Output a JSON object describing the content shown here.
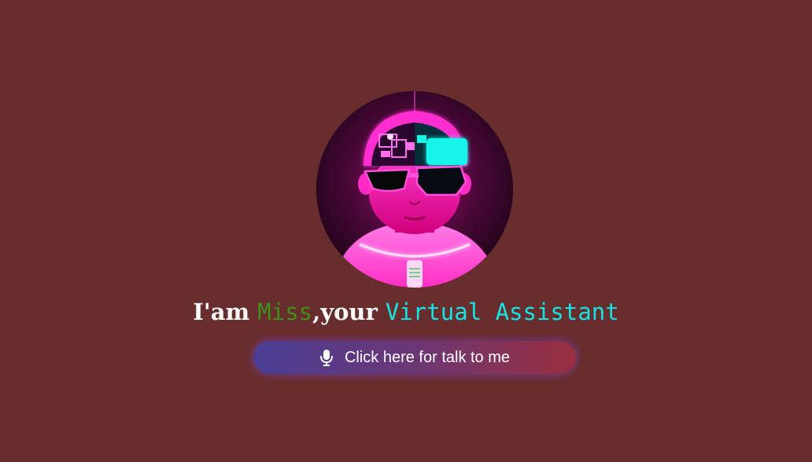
{
  "assistant": {
    "avatar_alt": "avatar",
    "heading": {
      "lead": "I'am ",
      "name": "Miss",
      "mid": ",your ",
      "role": "Virtual Assistant"
    },
    "name_color": "#3f8f1a",
    "role_color": "#14e4e4"
  },
  "talk_button": {
    "label": "Click here for talk to me",
    "icon": "microphone-icon",
    "gradient_colors": [
      "#4a3e95",
      "#9a2f3f"
    ]
  },
  "theme": {
    "background": "#682d2d",
    "neon_pink": "#ff1ad1",
    "neon_cyan": "#19f5e8"
  }
}
